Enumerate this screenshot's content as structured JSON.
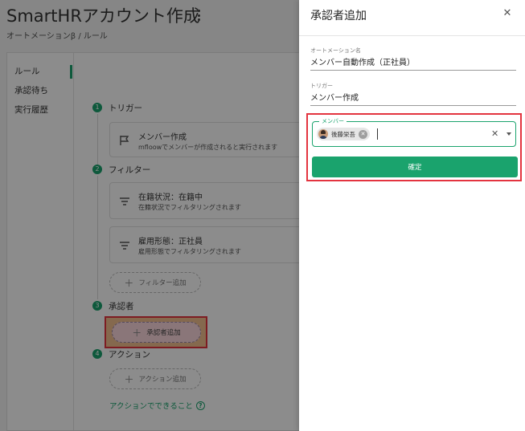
{
  "page": {
    "title": "SmartHRアカウント作成",
    "breadcrumb": "オートメーションβ / ルール"
  },
  "nav": {
    "items": [
      {
        "label": "ルール"
      },
      {
        "label": "承認待ち"
      },
      {
        "label": "実行履歴"
      }
    ]
  },
  "steps": [
    {
      "number": "1",
      "label": "トリガー"
    },
    {
      "number": "2",
      "label": "フィルター"
    },
    {
      "number": "3",
      "label": "承認者"
    },
    {
      "number": "4",
      "label": "アクション"
    }
  ],
  "trigger": {
    "icon": "flag-icon",
    "title": "メンバー作成",
    "subtitle": "mfloowでメンバーが作成されると実行されます"
  },
  "filters": [
    {
      "icon": "filter-icon",
      "title": "在籍状況：在籍中",
      "subtitle": "在籍状況でフィルタリングされます"
    },
    {
      "icon": "filter-icon",
      "title": "雇用形態：正社員",
      "subtitle": "雇用形態でフィルタリングされます"
    }
  ],
  "buttons": {
    "add_filter": "フィルター追加",
    "add_approver": "承認者追加",
    "add_action": "アクション追加"
  },
  "help_link": "アクションでできること",
  "drawer": {
    "title": "承認者追加",
    "fields": {
      "automation_name": {
        "label": "オートメーション名",
        "value": "メンバー自動作成（正社員）"
      },
      "trigger": {
        "label": "トリガー",
        "value": "メンバー作成"
      }
    },
    "member": {
      "label": "メンバー",
      "chip": "後藤栄吾"
    },
    "confirm_label": "確定"
  },
  "colors": {
    "accent": "#1aa36d",
    "highlight": "#e3343f"
  }
}
